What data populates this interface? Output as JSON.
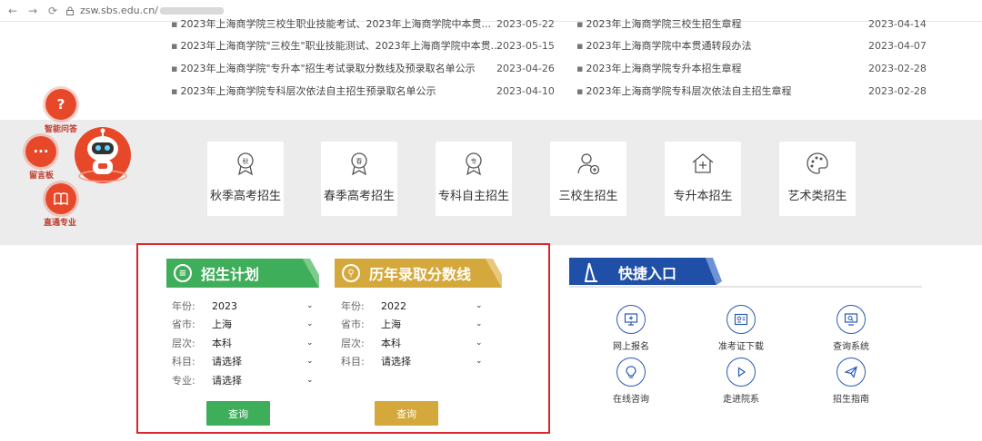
{
  "browser": {
    "url": "zsw.sbs.edu.cn/"
  },
  "news": {
    "rows": [
      {
        "title": "2023年上海商学院三校生职业技能考试、2023年上海商学院中本贯...",
        "date": "2023-05-22",
        "col": 0
      },
      {
        "title": "2023年上海商学院三校生招生章程",
        "date": "2023-04-14",
        "col": 1
      },
      {
        "title": "2023年上海商学院\"三校生\"职业技能测试、2023年上海商学院中本贯...",
        "date": "2023-05-15",
        "col": 0
      },
      {
        "title": "2023年上海商学院中本贯通转段办法",
        "date": "2023-04-07",
        "col": 1
      },
      {
        "title": "2023年上海商学院\"专升本\"招生考试录取分数线及预录取名单公示",
        "date": "2023-04-26",
        "col": 0
      },
      {
        "title": "2023年上海商学院专升本招生章程",
        "date": "2023-02-28",
        "col": 1
      },
      {
        "title": "2023年上海商学院专科层次依法自主招生预录取名单公示",
        "date": "2023-04-10",
        "col": 0
      },
      {
        "title": "2023年上海商学院专科层次依法自主招生章程",
        "date": "2023-02-28",
        "col": 1
      }
    ]
  },
  "side": {
    "ask_label": "智能问答",
    "board_label": "留言板",
    "major_label": "直通专业"
  },
  "categories": [
    {
      "label": "秋季高考招生",
      "icon": "autumn-medal-icon"
    },
    {
      "label": "春季高考招生",
      "icon": "spring-medal-icon"
    },
    {
      "label": "专科自主招生",
      "icon": "specialty-medal-icon"
    },
    {
      "label": "三校生招生",
      "icon": "person-add-icon"
    },
    {
      "label": "专升本招生",
      "icon": "house-plus-icon"
    },
    {
      "label": "艺术类招生",
      "icon": "palette-icon"
    }
  ],
  "plan": {
    "title": "招生计划",
    "fields": [
      {
        "label": "年份:",
        "value": "2023"
      },
      {
        "label": "省市:",
        "value": "上海"
      },
      {
        "label": "层次:",
        "value": "本科"
      },
      {
        "label": "科目:",
        "value": "请选择"
      },
      {
        "label": "专业:",
        "value": "请选择"
      }
    ],
    "button": "查询",
    "color": "#3fae5a"
  },
  "scores": {
    "title": "历年录取分数线",
    "fields": [
      {
        "label": "年份:",
        "value": "2022"
      },
      {
        "label": "省市:",
        "value": "上海"
      },
      {
        "label": "层次:",
        "value": "本科"
      },
      {
        "label": "科目:",
        "value": "请选择"
      }
    ],
    "button": "查询",
    "color": "#d4a83a"
  },
  "quick": {
    "title": "快捷入口",
    "items": [
      {
        "label": "网上报名",
        "icon": "online-signup-icon"
      },
      {
        "label": "准考证下载",
        "icon": "admission-ticket-icon"
      },
      {
        "label": "查询系统",
        "icon": "query-system-icon"
      },
      {
        "label": "在线咨询",
        "icon": "bulb-consult-icon"
      },
      {
        "label": "走进院系",
        "icon": "play-circle-icon"
      },
      {
        "label": "招生指南",
        "icon": "paper-plane-icon"
      }
    ],
    "color": "#1f4fa6"
  },
  "colors": {
    "highlight_border": "#d9262c",
    "band": "#ececec",
    "side_red": "#e8482a"
  }
}
